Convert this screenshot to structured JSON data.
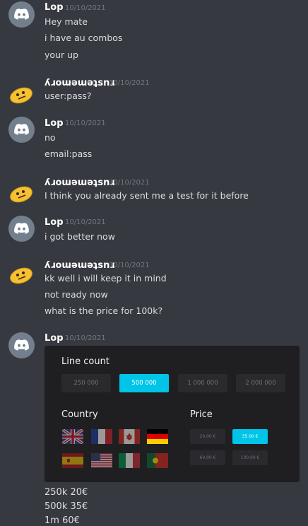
{
  "messages": [
    {
      "author": "Lop",
      "timestamp": "10/10/2021",
      "lines": [
        "Hey mate",
        "i have au combos",
        "your up"
      ]
    },
    {
      "author": "ʎɹoɯǝɯǝʇsnɹ",
      "timestamp": "10/10/2021",
      "lines": [
        "user:pass?"
      ]
    },
    {
      "author": "Lop",
      "timestamp": "10/10/2021",
      "lines": [
        "no",
        "email:pass"
      ]
    },
    {
      "author": "ʎɹoɯǝɯǝʇsnɹ",
      "timestamp": "10/10/2021",
      "lines": [
        "I think you already sent me a test for it before"
      ]
    },
    {
      "author": "Lop",
      "timestamp": "10/10/2021",
      "lines": [
        "i got better now"
      ]
    },
    {
      "author": "ʎɹoɯǝɯǝʇsnɹ",
      "timestamp": "10/10/2021",
      "lines": [
        "kk well i will keep it in mind",
        "not ready now",
        "what is the price for 100k?"
      ]
    },
    {
      "author": "Lop",
      "timestamp": "10/10/2021",
      "lines": []
    }
  ],
  "embed": {
    "line_count_title": "Line count",
    "line_counts": [
      "250 000",
      "500 000",
      "1 000 000",
      "2 000 000"
    ],
    "selected_line_count": "500 000",
    "country_title": "Country",
    "countries": [
      "uk",
      "france",
      "canada",
      "germany",
      "spain",
      "usa",
      "italy",
      "portugal"
    ],
    "selected_country": "germany",
    "price_title": "Price",
    "prices": [
      "20.00 €",
      "35.00 €",
      "60.00 €",
      "100.00 €"
    ],
    "selected_price": "35.00 €"
  },
  "trailing_lines": [
    "250k 20€",
    "500k 35€",
    "1m 60€"
  ],
  "colors": {
    "background": "#36393f",
    "accent": "#00c4e8",
    "timestamp": "#72767d"
  }
}
